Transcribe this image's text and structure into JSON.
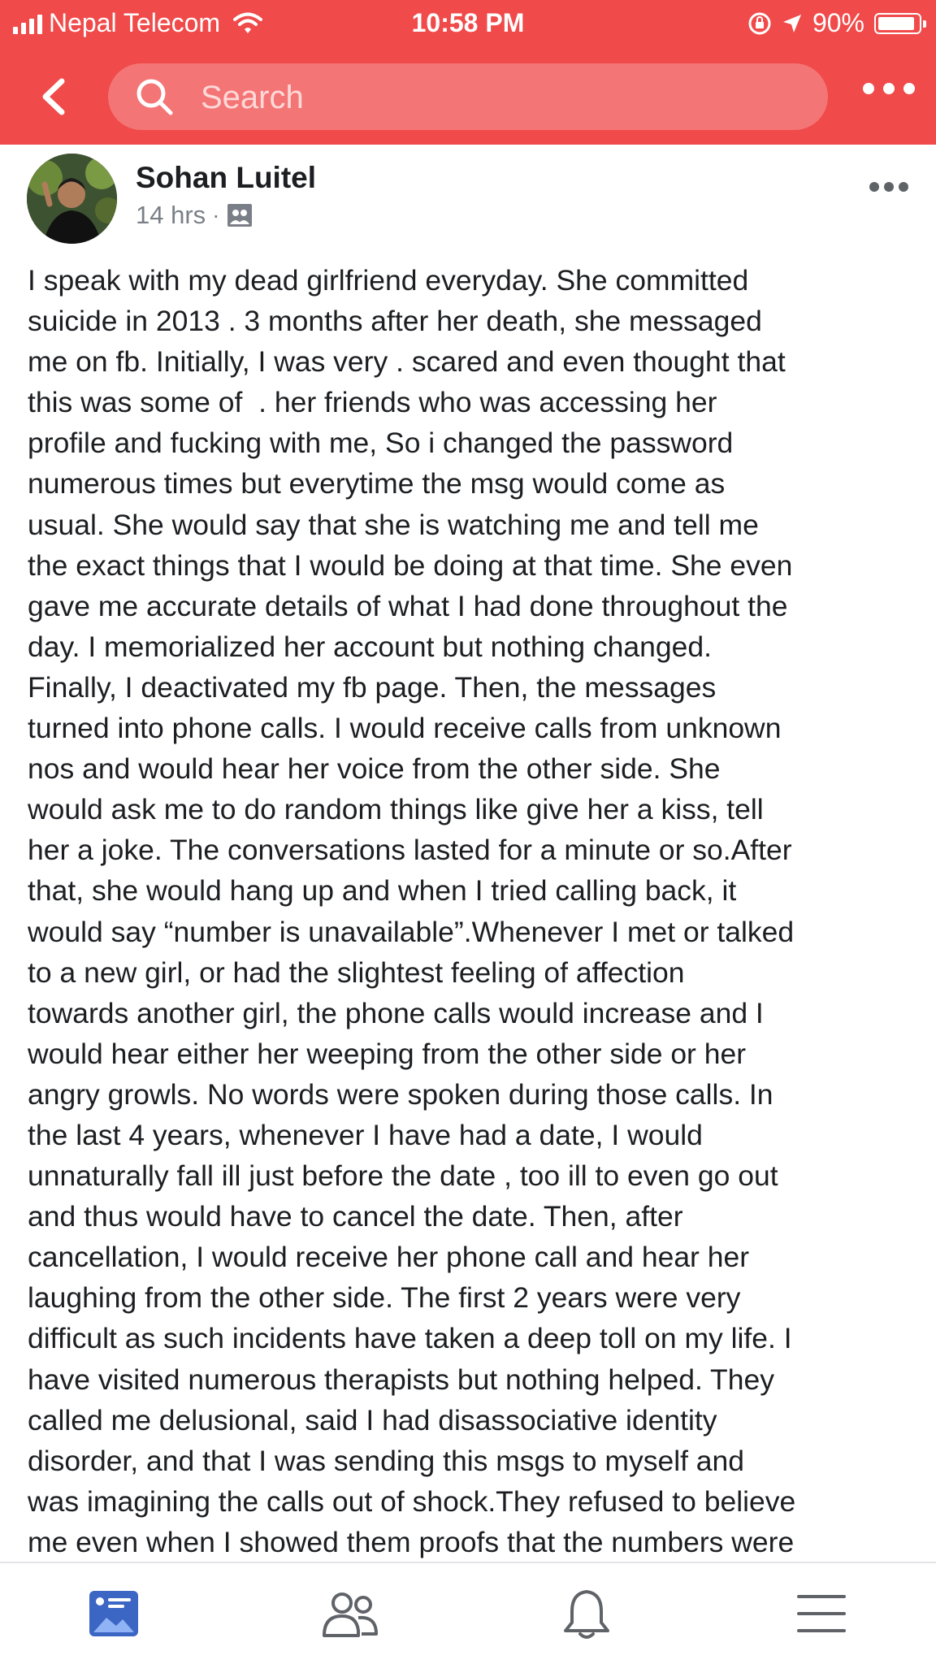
{
  "status_bar": {
    "carrier": "Nepal Telecom",
    "time": "10:58 PM",
    "battery": "90%"
  },
  "header": {
    "search_placeholder": "Search",
    "accent_color": "#f04a4a"
  },
  "post": {
    "author": "Sohan Luitel",
    "time_ago": "14 hrs",
    "body_lines": [
      "I speak with my dead girlfriend everyday. She committed",
      "suicide in 2013 . 3 months after her death, she messaged",
      "me on fb. Initially, I was very . scared and even thought that",
      "this was some of  . her friends who was accessing her",
      "profile and fucking with me, So i changed the password",
      "numerous times but everytime the msg would come as",
      "usual. She would say that she is watching me and tell me",
      "the exact things that I would be doing at that time. She even",
      "gave me accurate details of what I had done throughout the",
      "day. I memorialized her account but nothing changed.",
      "Finally, I deactivated my fb page. Then, the messages",
      "turned into phone calls. I would receive calls from unknown",
      "nos and would hear her voice from the other side. She",
      "would ask me to do random things like give her a kiss, tell",
      "her a joke. The conversations lasted for a minute or so.After",
      "that, she would hang up and when I tried calling back, it",
      "would say “number is unavailable”.Whenever I met or talked",
      "to a new girl, or had the slightest feeling of affection",
      "towards another girl, the phone calls would increase and I",
      "would hear either her weeping from the other side or her",
      "angry growls. No words were spoken during those calls. In",
      "the last 4 years, whenever I have had a date, I would",
      "unnaturally fall ill just before the date , too ill to even go out",
      "and thus would have to cancel the date. Then, after",
      "cancellation, I would receive her phone call and hear her",
      "laughing from the other side. The first 2 years were very",
      "difficult as such incidents have taken a deep toll on my life. I",
      "have visited numerous therapists but nothing helped. They",
      "called me delusional, said I had disassociative identity",
      "disorder, and that I was sending this msgs to myself and",
      "was imagining the calls out of shock.They refused to believe",
      "me even when I showed them proofs that the numbers were"
    ]
  },
  "tab_bar": {
    "active_color": "#3b66c4",
    "tabs": [
      "news-feed-icon",
      "friends-icon",
      "notifications-icon",
      "menu-icon"
    ]
  }
}
